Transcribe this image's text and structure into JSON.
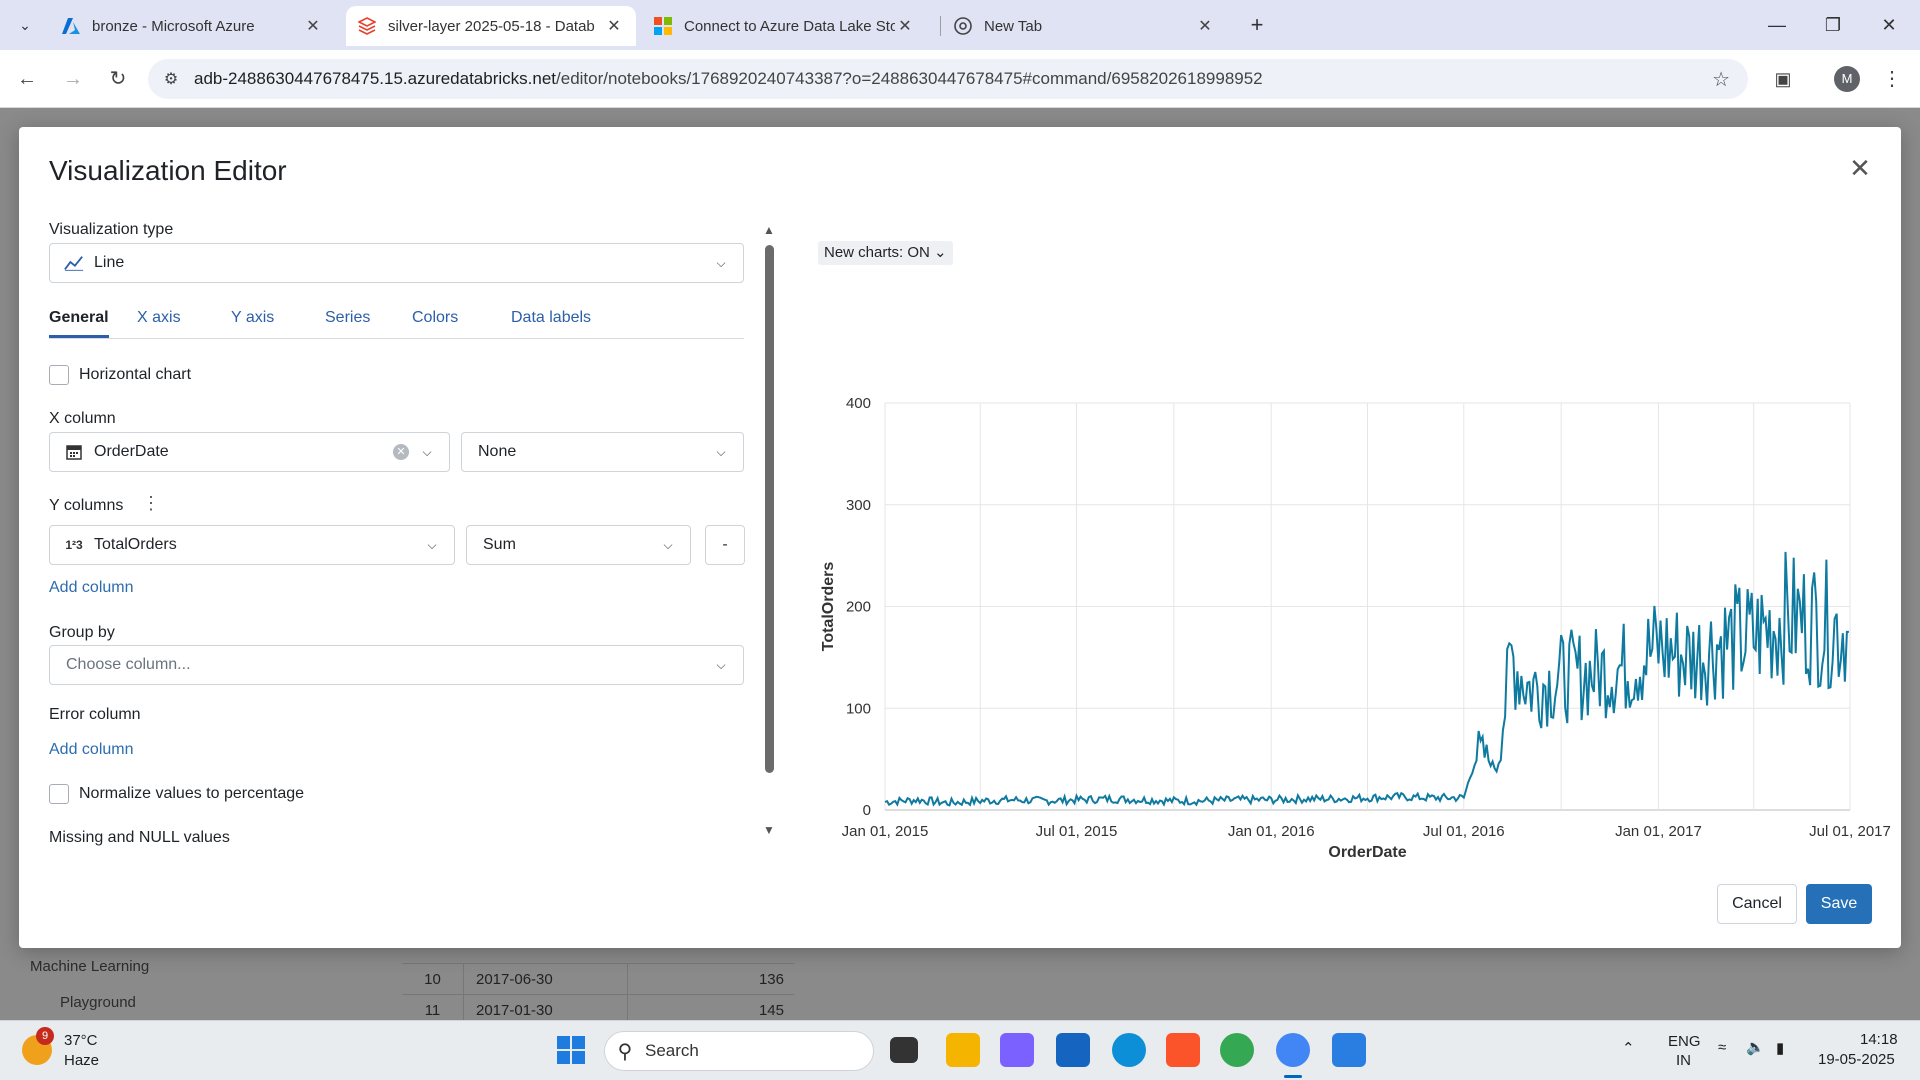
{
  "browser": {
    "tabs": [
      {
        "title": "bronze - Microsoft Azure",
        "active": false
      },
      {
        "title": "silver-layer 2025-05-18 - Datab",
        "active": true
      },
      {
        "title": "Connect to Azure Data Lake Sto",
        "active": false
      },
      {
        "title": "New Tab",
        "active": false
      }
    ],
    "url_domain": "adb-2488630447678475.15.azuredatabricks.net",
    "url_path": "/editor/notebooks/1768920240743387?o=2488630447678475#command/6958202618998952",
    "profile_initial": "M"
  },
  "background": {
    "sidebar": [
      "Machine Learning",
      "Playground"
    ],
    "rows": [
      {
        "n": "10",
        "date": "2017-06-30",
        "value": "136"
      },
      {
        "n": "11",
        "date": "2017-01-30",
        "value": "145"
      }
    ]
  },
  "modal": {
    "title": "Visualization Editor",
    "viz_type_label": "Visualization type",
    "viz_type_value": "Line",
    "tabs": [
      "General",
      "X axis",
      "Y axis",
      "Series",
      "Colors",
      "Data labels"
    ],
    "horizontal_chart_label": "Horizontal chart",
    "x_column_label": "X column",
    "x_column_value": "OrderDate",
    "x_scale_value": "None",
    "y_columns_label": "Y columns",
    "y_column_value": "TotalOrders",
    "y_agg_value": "Sum",
    "remove_label": "-",
    "add_column_label": "Add column",
    "group_by_label": "Group by",
    "group_by_placeholder": "Choose column...",
    "error_column_label": "Error column",
    "error_add_column_label": "Add column",
    "normalize_label": "Normalize values to percentage",
    "missing_label": "Missing and NULL values",
    "new_charts_label": "New charts: ON",
    "cancel_label": "Cancel",
    "save_label": "Save"
  },
  "chart_data": {
    "type": "line",
    "xlabel": "OrderDate",
    "ylabel": "TotalOrders",
    "ylim": [
      0,
      400
    ],
    "yticks": [
      "0",
      "100",
      "200",
      "300",
      "400"
    ],
    "xticks": [
      "Jan 01, 2015",
      "Jul 01, 2015",
      "Jan 01, 2016",
      "Jul 01, 2016",
      "Jan 01, 2017",
      "Jul 01, 2017"
    ],
    "grid": true,
    "color": "#0f7aa0",
    "series": [
      {
        "x": [
          "2015-01-01",
          "2015-02-01",
          "2015-03-01",
          "2015-04-01",
          "2015-05-01",
          "2015-06-01",
          "2015-07-01",
          "2015-08-01",
          "2015-09-01",
          "2015-10-01",
          "2015-11-01",
          "2015-12-01",
          "2016-01-01",
          "2016-02-01",
          "2016-03-01",
          "2016-04-01",
          "2016-05-01",
          "2016-06-01",
          "2016-07-01",
          "2016-07-15",
          "2016-08-01",
          "2016-08-15",
          "2016-09-01",
          "2016-10-01",
          "2016-11-01",
          "2016-12-01",
          "2017-01-01",
          "2017-02-01",
          "2017-03-01",
          "2017-04-01",
          "2017-05-01",
          "2017-06-01",
          "2017-06-30"
        ],
        "values": [
          8,
          10,
          7,
          9,
          10,
          9,
          10,
          11,
          10,
          9,
          9,
          10,
          10,
          11,
          11,
          12,
          13,
          12,
          12,
          60,
          40,
          150,
          120,
          130,
          135,
          140,
          160,
          150,
          165,
          170,
          190,
          185,
          175
        ]
      }
    ]
  },
  "taskbar": {
    "weather_badge": "9",
    "temperature": "37°C",
    "condition": "Haze",
    "search_label": "Search",
    "lang_top": "ENG",
    "lang_bottom": "IN",
    "time": "14:18",
    "date": "19-05-2025"
  }
}
